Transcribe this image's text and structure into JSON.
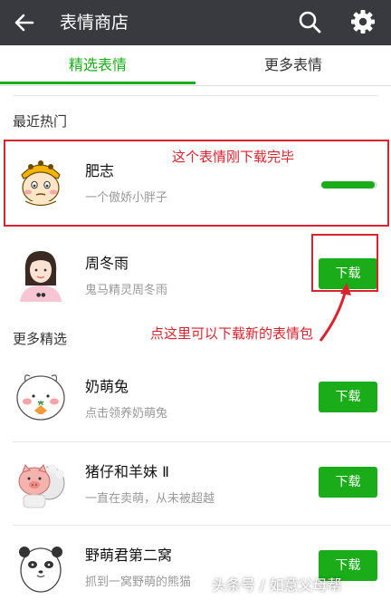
{
  "header": {
    "title": "表情商店",
    "icons": [
      "back-icon",
      "search-icon",
      "gear-icon"
    ]
  },
  "tabs": [
    {
      "label": "精选表情",
      "active": true
    },
    {
      "label": "更多表情",
      "active": false
    }
  ],
  "recent": {
    "title": "最近热门",
    "items": [
      {
        "name": "肥志",
        "desc": "一个傲娇小胖子",
        "progress": 0.95
      },
      {
        "name": "周冬雨",
        "desc": "鬼马精灵周冬雨",
        "button": "下载"
      }
    ]
  },
  "more": {
    "title": "更多精选",
    "items": [
      {
        "name": "奶萌兔",
        "desc": "点击领养奶萌兔",
        "button": "下载"
      },
      {
        "name": "猪仔和羊妹 Ⅱ",
        "desc": "一直在卖萌，从未被超越",
        "button": "下载"
      },
      {
        "name": "野萌君第二窝",
        "desc": "抓到一窝野萌的熊猫",
        "button": "下载"
      }
    ]
  },
  "annotations": {
    "downloaded": "这个表情刚下载完毕",
    "tap_here": "点这里可以下载新的表情包"
  },
  "watermark": "头条号 / 如意父母帮",
  "colors": {
    "header_bg": "#393a3f",
    "accent": "#1aad19",
    "annotation": "#d9232e"
  }
}
